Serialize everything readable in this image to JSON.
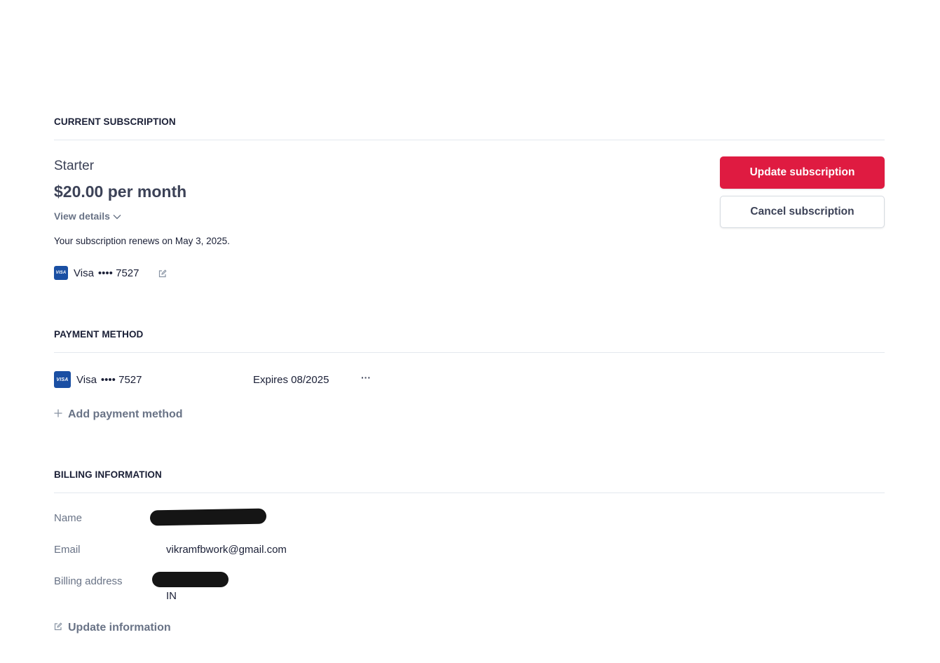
{
  "subscription": {
    "section_title": "CURRENT SUBSCRIPTION",
    "plan_name": "Starter",
    "price": "$20.00 per month",
    "view_details_label": "View details",
    "renewal_text": "Your subscription renews on May 3, 2025.",
    "card_brand": "Visa",
    "card_masked": "•••• 7527",
    "update_button_label": "Update subscription",
    "cancel_button_label": "Cancel subscription"
  },
  "payment": {
    "section_title": "PAYMENT METHOD",
    "card_brand": "Visa",
    "card_masked": "•••• 7527",
    "expires": "Expires 08/2025",
    "more_label": "···",
    "add_label": "Add payment method"
  },
  "billing": {
    "section_title": "BILLING INFORMATION",
    "name_label": "Name",
    "email_label": "Email",
    "email_value": "vikramfbwork@gmail.com",
    "address_label": "Billing address",
    "address_country": "IN",
    "update_label": "Update information"
  },
  "colors": {
    "accent": "#df1b41",
    "card": "#1a4fa3"
  },
  "icons": {
    "visa": "VISA",
    "edit": "edit-icon",
    "chevron": "chevron-down-icon",
    "plus": "plus-icon"
  }
}
